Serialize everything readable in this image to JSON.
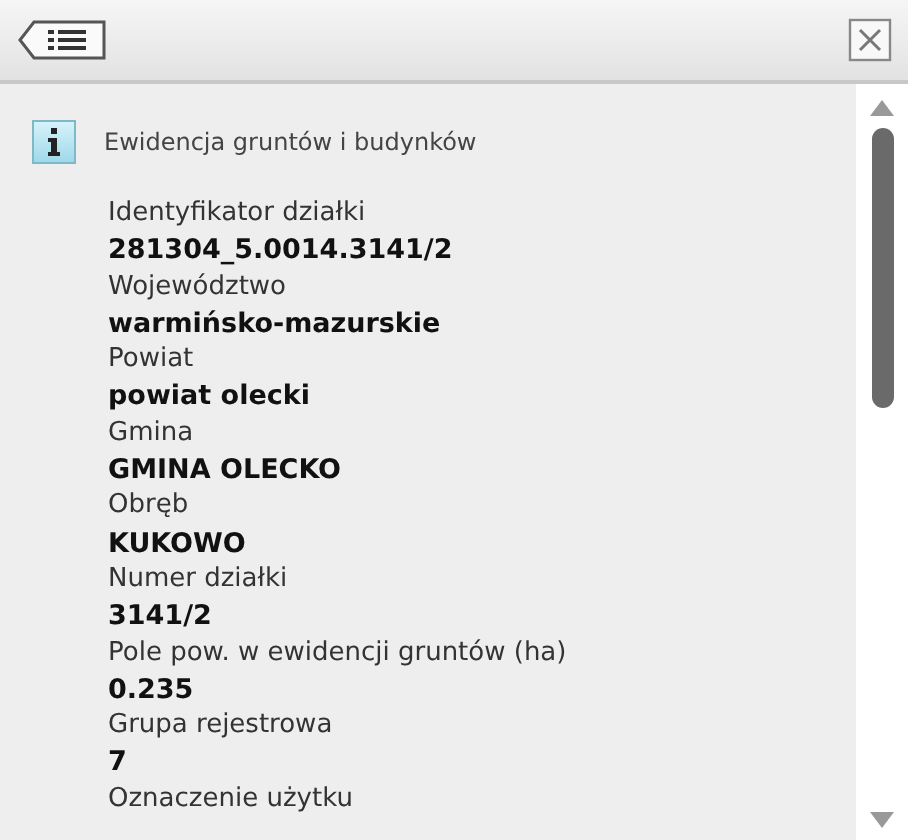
{
  "section_title": "Ewidencja gruntów i budynków",
  "fields": [
    {
      "label": "Identyfikator działki",
      "value": "281304_5.0014.3141/2"
    },
    {
      "label": "Województwo",
      "value": "warmińsko-mazurskie"
    },
    {
      "label": "Powiat",
      "value": "powiat olecki"
    },
    {
      "label": "Gmina",
      "value": "GMINA OLECKO"
    },
    {
      "label": "Obręb",
      "value": "KUKOWO"
    },
    {
      "label": "Numer działki",
      "value": "3141/2"
    },
    {
      "label": "Pole pow. w ewidencji gruntów (ha)",
      "value": "0.235"
    },
    {
      "label": "Grupa rejestrowa",
      "value": "7"
    }
  ],
  "trailing_label": "Oznaczenie użytku"
}
